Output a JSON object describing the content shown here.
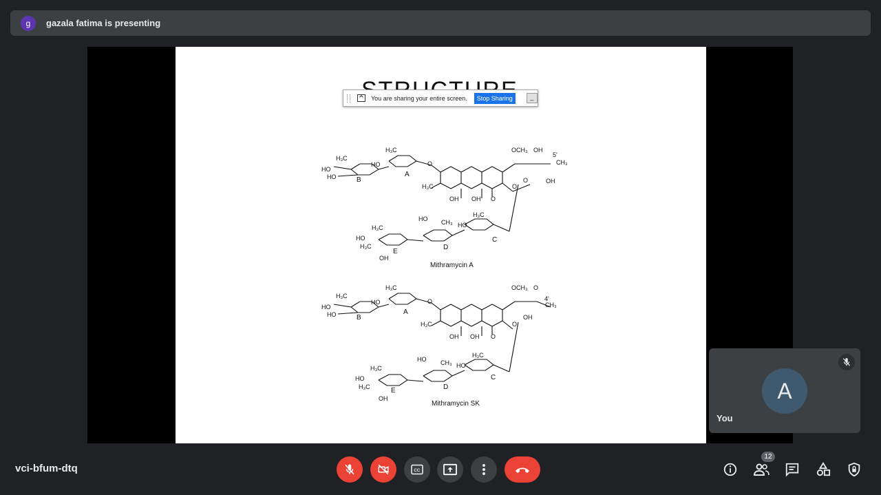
{
  "presenter": {
    "initial": "g",
    "banner_text": "gazala fatima is presenting"
  },
  "slide": {
    "title": "STRUCTURE",
    "share_bar": {
      "message": "You are sharing your entire screen.",
      "stop_label": "Stop Sharing",
      "minimize_label": "_"
    },
    "structures": [
      {
        "name": "Mithramycin A"
      },
      {
        "name": "Mithramycin SK"
      }
    ]
  },
  "self_tile": {
    "initial": "A",
    "name": "You"
  },
  "meeting": {
    "code": "vci-bfum-dtq"
  },
  "controls": {
    "mic": "mic-off-icon",
    "camera": "camera-off-icon",
    "captions": "captions-icon",
    "present": "present-icon",
    "more": "more-options-icon",
    "end_call": "end-call-icon"
  },
  "right_panel": {
    "info": "info-icon",
    "people_count": "12",
    "chat": "chat-icon",
    "activities": "activities-icon",
    "host_controls": "host-controls-icon"
  },
  "colors": {
    "bg": "#202124",
    "surface": "#3c4043",
    "red": "#ea4335",
    "blue": "#1a73e8"
  }
}
